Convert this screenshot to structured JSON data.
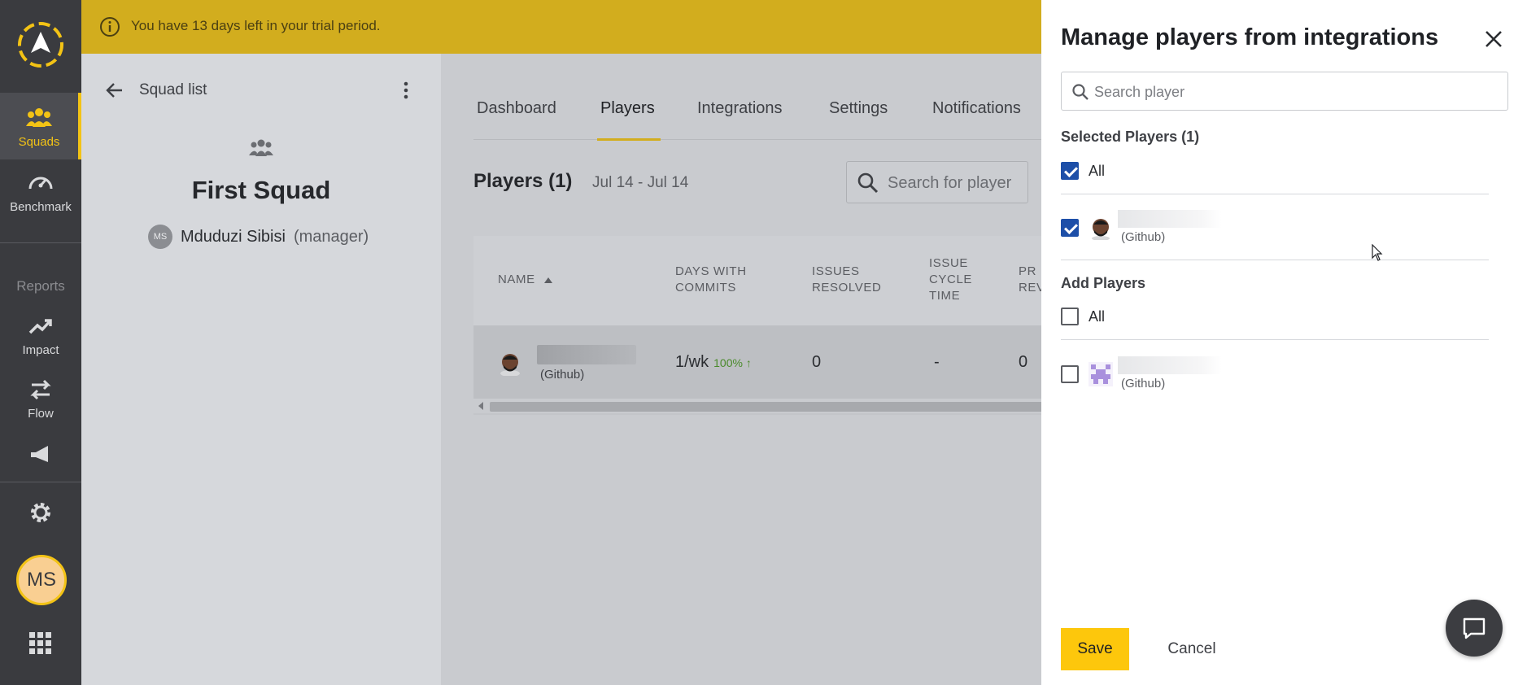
{
  "nav": {
    "items": [
      {
        "label": "Squads",
        "icon": "people-icon",
        "active": true
      },
      {
        "label": "Benchmark",
        "icon": "speedometer-icon",
        "active": false
      }
    ],
    "reports_section": "Reports",
    "report_items": [
      {
        "label": "Impact",
        "icon": "trending-up-icon"
      },
      {
        "label": "Flow",
        "icon": "swap-arrows-icon"
      }
    ],
    "avatar_initials": "MS"
  },
  "banner": {
    "text": "You have 13 days left in your trial period.",
    "color": "#d2ad1e"
  },
  "squad_panel": {
    "back_label": "Squad list",
    "squad_name": "First Squad",
    "manager_initials": "MS",
    "manager_name": "Mduduzi Sibisi",
    "manager_role": "(manager)"
  },
  "main": {
    "tabs": [
      {
        "label": "Dashboard",
        "active": false
      },
      {
        "label": "Players",
        "active": true
      },
      {
        "label": "Integrations",
        "active": false
      },
      {
        "label": "Settings",
        "active": false
      },
      {
        "label": "Notifications",
        "active": false
      }
    ],
    "players_title": "Players (1)",
    "date_range": "Jul 14 - Jul 14",
    "search_placeholder": "Search for player",
    "table": {
      "columns": [
        {
          "line1": "NAME",
          "line2": "",
          "line3": ""
        },
        {
          "line1": "DAYS WITH",
          "line2": "COMMITS",
          "line3": ""
        },
        {
          "line1": "ISSUES",
          "line2": "RESOLVED",
          "line3": ""
        },
        {
          "line1": "ISSUE",
          "line2": "CYCLE",
          "line3": "TIME"
        },
        {
          "line1": "PR",
          "line2": "REV",
          "line3": ""
        }
      ],
      "rows": [
        {
          "source": "(Github)",
          "days_with_commits": "1/wk",
          "commits_change": "100% ↑",
          "issues_resolved": "0",
          "issue_cycle_time": "-",
          "pr_rev": "0"
        }
      ]
    }
  },
  "drawer": {
    "title": "Manage players from integrations",
    "search_placeholder": "Search player",
    "selected_label": "Selected Players (1)",
    "selected_all_label": "All",
    "selected_players": [
      {
        "source": "(Github)",
        "checked": true
      }
    ],
    "add_label": "Add Players",
    "add_all_label": "All",
    "add_players": [
      {
        "source": "(Github)",
        "checked": false
      }
    ],
    "save_label": "Save",
    "cancel_label": "Cancel",
    "accent": "#fdc70c",
    "checkbox_color": "#1d4fa8"
  }
}
